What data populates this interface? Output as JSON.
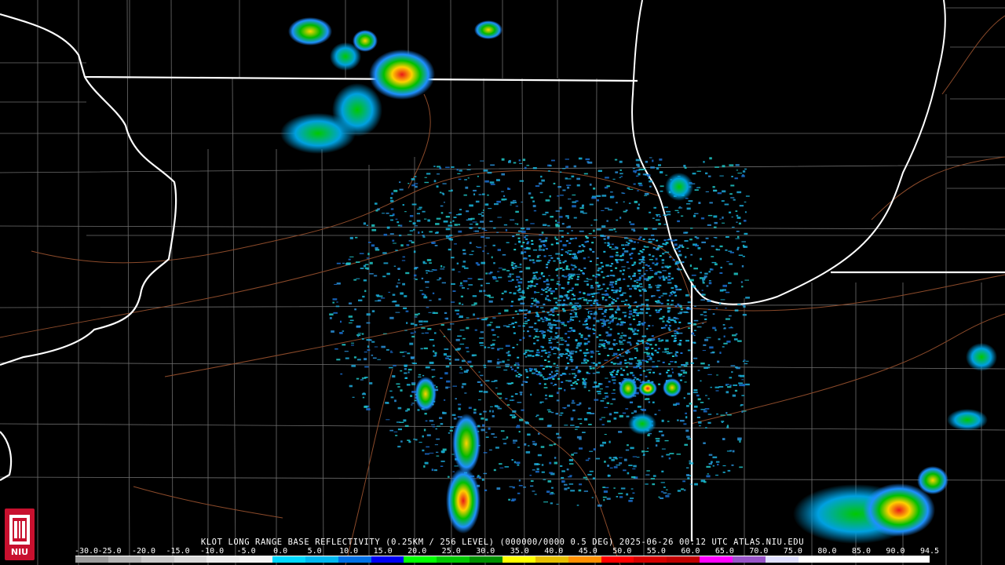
{
  "caption": "KLOT LONG RANGE BASE REFLECTIVITY (0.25KM / 256 LEVEL) (000000/0000 0.5 DEG) 2025-06-26 00:12 UTC  ATLAS.NIU.EDU",
  "logo_text": "NIU",
  "scale": {
    "labels": [
      "-30.0",
      "-25.0",
      "-20.0",
      "-15.0",
      "-10.0",
      "-5.0",
      "0.0",
      "5.0",
      "10.0",
      "15.0",
      "20.0",
      "25.0",
      "30.0",
      "35.0",
      "40.0",
      "45.0",
      "50.0",
      "55.0",
      "60.0",
      "65.0",
      "70.0",
      "75.0",
      "80.0",
      "85.0",
      "90.0",
      "94.5"
    ],
    "colors": [
      "#9c9c9c",
      "#b4b4b4",
      "#cacaca",
      "#dadada",
      "#ececec",
      "#f4f4f4",
      "#00d8ff",
      "#00b8f0",
      "#0070e6",
      "#0000f6",
      "#00ff00",
      "#00c800",
      "#009000",
      "#ffff00",
      "#e7c000",
      "#ff9000",
      "#ff0000",
      "#d60000",
      "#c00000",
      "#ff00ff",
      "#9955c9",
      "#e0e0ff",
      "#ffffff",
      "#ffffff",
      "#ffffff",
      "#ffffff"
    ]
  },
  "colors": {
    "background": "#000000",
    "state_border": "#ffffff",
    "county_line": "#7a7a7a",
    "highway": "#8b4a2a",
    "light_echo": "#1ea8d8",
    "moderate_echo": "#00d000",
    "heavy_echo": "#ff2020"
  }
}
